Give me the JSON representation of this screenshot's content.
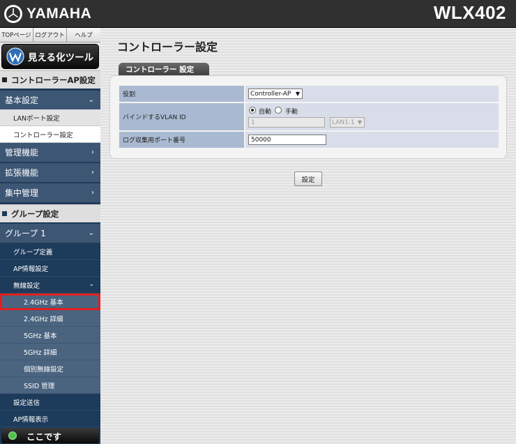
{
  "header": {
    "brand": "YAMAHA",
    "model": "WLX402"
  },
  "topnav": {
    "items": [
      "TOPページ",
      "ログアウト",
      "ヘルプ"
    ]
  },
  "sidebar": {
    "visualize_tool": "見える化ツール",
    "section_controller": "コントローラーAP設定",
    "cat_basic": "基本設定",
    "sub_lan": "LANポート設定",
    "sub_controller": "コントローラー設定",
    "cat_manage": "管理機能",
    "cat_extend": "拡張機能",
    "cat_central": "集中管理",
    "section_group": "グループ設定",
    "group1": "グループ 1",
    "group_items": {
      "def": "グループ定義",
      "ap_info": "AP情報設定",
      "wireless": "無線設定",
      "g24_basic": "2.4GHz 基本",
      "g24_detail": "2.4GHz 詳細",
      "g5_basic": "5GHz 基本",
      "g5_detail": "5GHz 詳細",
      "individual": "個別無線設定",
      "ssid": "SSID 管理",
      "send": "設定送信",
      "ap_display": "AP情報表示"
    },
    "here": "ここです",
    "highlight_color": "#e02020"
  },
  "main": {
    "title": "コントローラー設定",
    "tab": "コントローラー 設定",
    "rows": {
      "role_label": "役割",
      "role_value": "Controller-AP",
      "vlan_label": "バインドするVLAN ID",
      "vlan_auto": "自動",
      "vlan_manual": "手動",
      "vlan_id_value": "1",
      "vlan_port_value": "LAN1:1",
      "log_label": "ログ収集用ポート番号",
      "log_value": "50000"
    },
    "submit": "設定"
  }
}
